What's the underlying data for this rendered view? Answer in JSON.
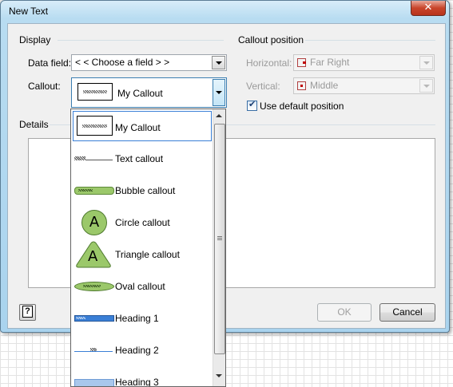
{
  "window": {
    "title": "New Text",
    "close_label": "✕"
  },
  "display": {
    "section_label": "Display",
    "data_field_label": "Data field:",
    "data_field_value": "< < Choose a field > >",
    "callout_label": "Callout:",
    "callout_value": "My Callout"
  },
  "callout_position": {
    "section_label": "Callout position",
    "horizontal_label": "Horizontal:",
    "horizontal_value": "Far Right",
    "vertical_label": "Vertical:",
    "vertical_value": "Middle",
    "use_default_label": "Use default position",
    "use_default_checked": true
  },
  "details": {
    "section_label": "Details"
  },
  "dropdown": {
    "items": [
      {
        "label": "My Callout",
        "icon": "my-callout-swatch",
        "selected": true
      },
      {
        "label": "Text callout",
        "icon": "text-callout-swatch"
      },
      {
        "label": "Bubble callout",
        "icon": "bubble-callout-swatch"
      },
      {
        "label": "Circle callout",
        "icon": "circle-callout-swatch",
        "glyph": "A"
      },
      {
        "label": "Triangle callout",
        "icon": "triangle-callout-swatch",
        "glyph": "A"
      },
      {
        "label": "Oval callout",
        "icon": "oval-callout-swatch"
      },
      {
        "label": "Heading 1",
        "icon": "heading-1-swatch"
      },
      {
        "label": "Heading 2",
        "icon": "heading-2-swatch"
      },
      {
        "label": "Heading 3",
        "icon": "heading-3-swatch"
      }
    ]
  },
  "buttons": {
    "ok": "OK",
    "cancel": "Cancel",
    "help": "?"
  },
  "colors": {
    "accent": "#3a7fd6",
    "callout_green": "#9bc86a",
    "heading_blue": "#3a7fd6"
  }
}
